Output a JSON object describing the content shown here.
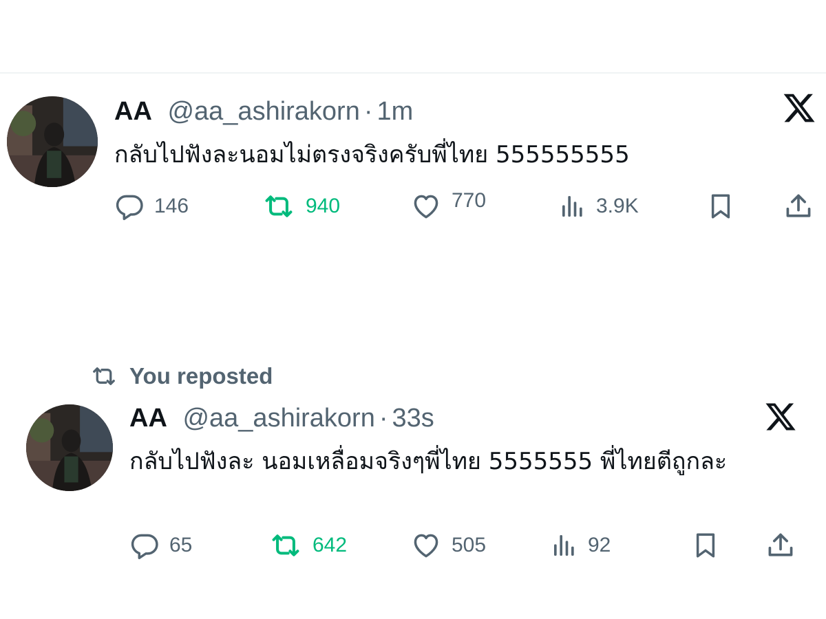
{
  "colors": {
    "text_primary": "#0f1419",
    "text_secondary": "#536471",
    "repost_green": "#00ba7c",
    "divider": "#eff3f4"
  },
  "tweets": [
    {
      "name": "AA",
      "handle": "@aa_ashirakorn",
      "separator": "·",
      "time": "1m",
      "text": "กลับไปฟังละนอมไม่ตรงจริงครับพี่ไทย 555555555",
      "reposted_banner": null,
      "actions": {
        "replies": "146",
        "reposts": "940",
        "likes": "770",
        "views": "3.9K"
      },
      "reposted_by_you": true,
      "brand_icon": "x-logo-icon"
    },
    {
      "name": "AA",
      "handle": "@aa_ashirakorn",
      "separator": "·",
      "time": "33s",
      "text": "กลับไปฟังละ นอมเหลื่อมจริงๆพี่ไทย 5555555 พี่ไทยตีถูกละ",
      "reposted_banner": "You reposted",
      "actions": {
        "replies": "65",
        "reposts": "642",
        "likes": "505",
        "views": "92"
      },
      "reposted_by_you": true,
      "brand_icon": "x-logo-icon"
    }
  ],
  "icons": {
    "reply": "reply-bubble-icon",
    "repost": "repost-arrows-icon",
    "like": "heart-icon",
    "views": "views-bar-chart-icon",
    "bookmark": "bookmark-icon",
    "share": "share-upload-icon"
  }
}
